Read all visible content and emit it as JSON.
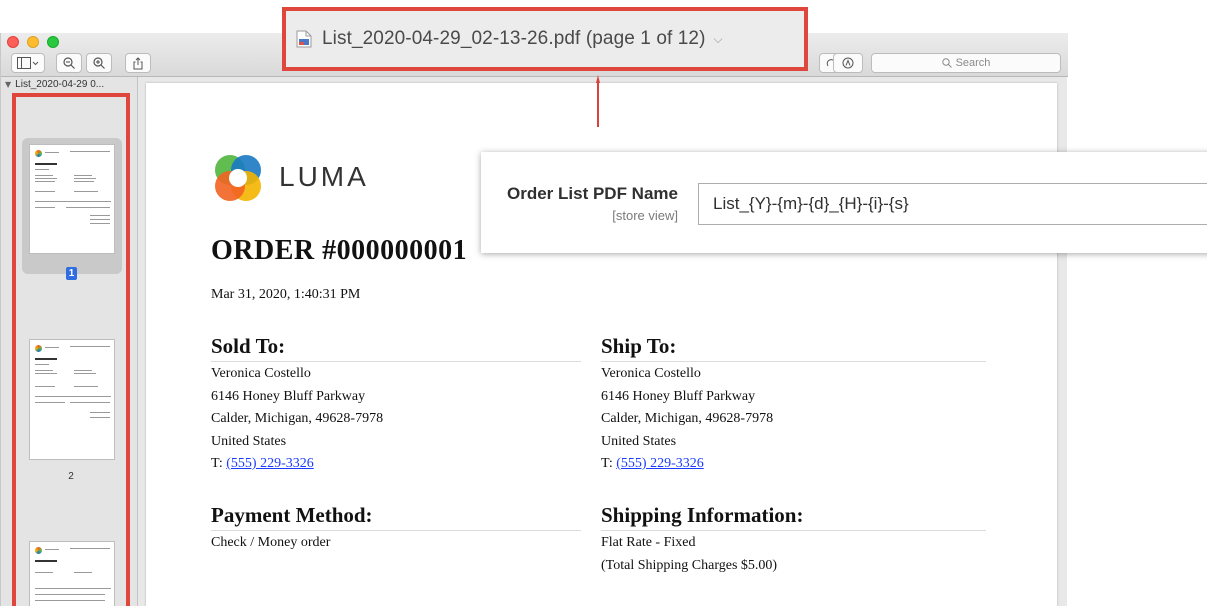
{
  "window": {
    "title": "List_2020-04-29_02-13-26.pdf (page 1 of 12)",
    "search_placeholder": "Search"
  },
  "sidebar": {
    "header": "List_2020-04-29 0...",
    "pages": [
      {
        "number": "1",
        "selected": true
      },
      {
        "number": "2",
        "selected": false
      },
      {
        "number": "",
        "selected": false
      }
    ]
  },
  "document": {
    "logo_text": "LUMA",
    "order_title": "ORDER #000000001",
    "order_date": "Mar 31, 2020, 1:40:31 PM",
    "sold_to": {
      "heading": "Sold To:",
      "name": "Veronica Costello",
      "street": "6146 Honey Bluff Parkway",
      "city": "Calder, Michigan, 49628-7978",
      "country": "United States",
      "phone_prefix": "T: ",
      "phone": "(555) 229-3326"
    },
    "ship_to": {
      "heading": "Ship To:",
      "name": "Veronica Costello",
      "street": "6146 Honey Bluff Parkway",
      "city": "Calder, Michigan, 49628-7978",
      "country": "United States",
      "phone_prefix": "T: ",
      "phone": "(555) 229-3326"
    },
    "payment": {
      "heading": "Payment Method:",
      "line1": "Check / Money order"
    },
    "shipping": {
      "heading": "Shipping Information:",
      "line1": "Flat Rate - Fixed",
      "line2": "(Total Shipping Charges $5.00)"
    }
  },
  "setting": {
    "label": "Order List PDF Name",
    "scope": "[store view]",
    "value": "List_{Y}-{m}-{d}_{H}-{i}-{s}"
  },
  "colors": {
    "highlight": "#e0473c",
    "link": "#1a3cff",
    "selection": "#2f6de1"
  }
}
